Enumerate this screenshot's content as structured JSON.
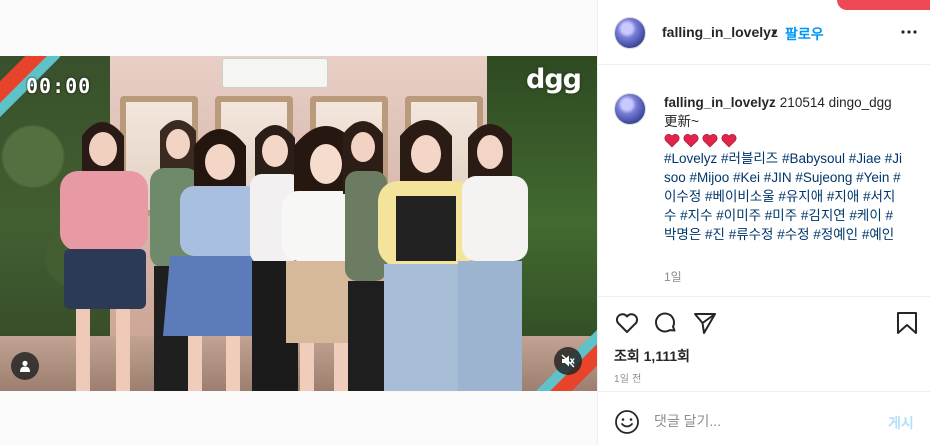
{
  "media": {
    "timecode": "00:00",
    "logo_text": "dgg",
    "user_tag_icon": "user-silhouette-icon",
    "mute_icon": "speaker-muted-icon"
  },
  "post": {
    "author": "falling_in_lovelyz",
    "follow_label": "팔로우",
    "separator": "•",
    "caption_line1": "210514 dingo_dgg",
    "caption_line2": "更新~",
    "hearts_count": 4,
    "hashtags": "#Lovelyz #러블리즈 #Babysoul #Jiae #Jisoo #Mijoo #Kei #JIN #Sujeong #Yein #이수정 #베이비소울 #유지애 #지애 #서지수 #지수 #이미주 #미주 #김지연 #케이 #박명은 #진 #류수정 #수정 #정예인 #예인",
    "caption_time": "1일",
    "views": "조회 1,111회",
    "posted_ago": "1일 전"
  },
  "comment": {
    "placeholder": "댓글 달기...",
    "post_label": "게시"
  },
  "colors": {
    "link_blue": "#0095f6",
    "hashtag": "#00376b",
    "heart_red": "#e0244a",
    "notification": "#ed4956"
  }
}
